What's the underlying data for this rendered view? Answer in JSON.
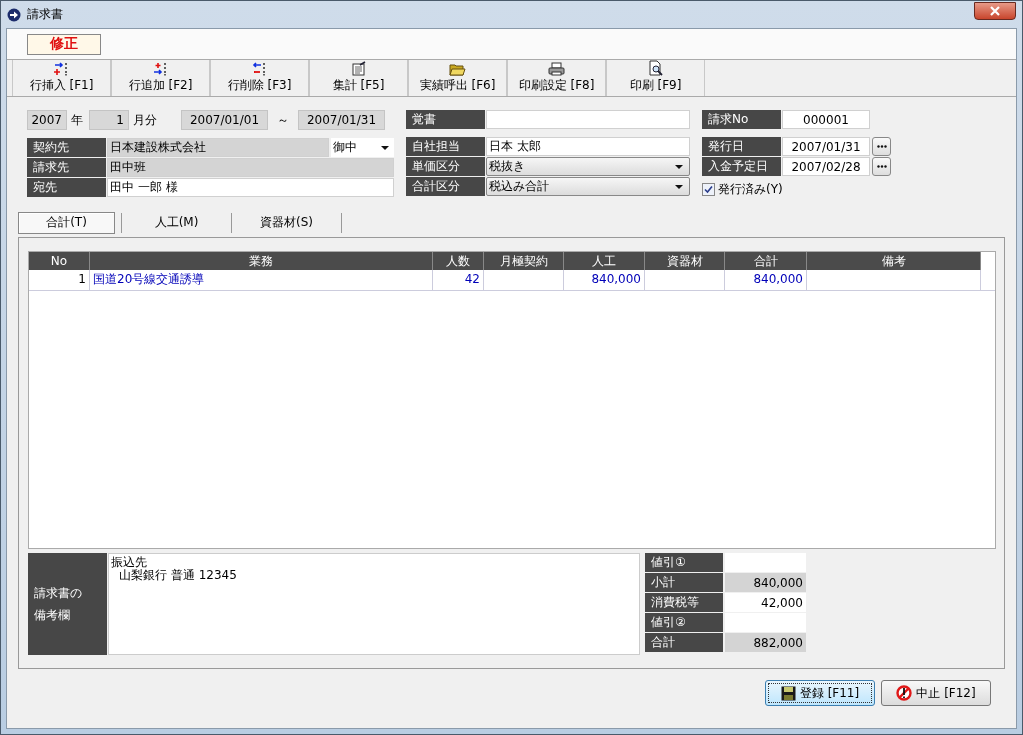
{
  "window": {
    "title": "請求書"
  },
  "mode_label": "修正",
  "toolbar": [
    {
      "label": "行挿入 [F1]",
      "kind": "insert"
    },
    {
      "label": "行追加 [F2]",
      "kind": "append"
    },
    {
      "label": "行削除 [F3]",
      "kind": "delete"
    },
    {
      "label": "集計 [F5]",
      "kind": "sum"
    },
    {
      "label": "実績呼出 [F6]",
      "kind": "load"
    },
    {
      "label": "印刷設定 [F8]",
      "kind": "printer"
    },
    {
      "label": "印刷 [F9]",
      "kind": "preview"
    }
  ],
  "period": {
    "year": "2007",
    "year_unit": "年",
    "month": "1",
    "month_unit": "月分",
    "start": "2007/01/01",
    "separator": "～",
    "end": "2007/01/31"
  },
  "client_fields": [
    {
      "label": "契約先",
      "value": "日本建設株式会社",
      "kind": "readonly",
      "honorific": "御中"
    },
    {
      "label": "請求先",
      "value": "田中班",
      "kind": "readonly"
    },
    {
      "label": "宛先",
      "value": "田中 一郎 様",
      "kind": "text"
    }
  ],
  "memo": {
    "label": "覚書"
  },
  "setting_fields": [
    {
      "label": "自社担当",
      "value": "日本 太郎",
      "kind": "text"
    },
    {
      "label": "単価区分",
      "value": "税抜き",
      "kind": "select"
    },
    {
      "label": "合計区分",
      "value": "税込み合計",
      "kind": "select"
    }
  ],
  "invoice_no": {
    "label": "請求No",
    "value": "000001"
  },
  "date_fields": [
    {
      "label": "発行日",
      "value": "2007/01/31"
    },
    {
      "label": "入金予定日",
      "value": "2007/02/28"
    }
  ],
  "issued": {
    "label": "発行済み(Y)",
    "checked": true
  },
  "tabs": [
    {
      "label": "合計(T)",
      "selected": true
    },
    {
      "label": "人工(M)",
      "selected": false
    },
    {
      "label": "資器材(S)",
      "selected": false
    }
  ],
  "table": {
    "columns": [
      "No",
      "業務",
      "人数",
      "月極契約",
      "人工",
      "資器材",
      "合計",
      "備考"
    ],
    "rows": [
      [
        "1",
        "国道20号線交通誘導",
        "42",
        null,
        "840,000",
        null,
        "840,000",
        null
      ]
    ]
  },
  "remarks": {
    "label": "請求書の備考欄",
    "lines": [
      "振込先",
      "山梨銀行 普通 12345"
    ]
  },
  "totals": [
    {
      "label": "値引①",
      "kind": "input"
    },
    {
      "label": "小計",
      "value": "840,000",
      "kind": "readonly"
    },
    {
      "label": "消費税等",
      "value": "42,000",
      "kind": "input"
    },
    {
      "label": "値引②",
      "kind": "input"
    },
    {
      "label": "合計",
      "value": "882,000",
      "kind": "readonly"
    }
  ],
  "buttons": [
    {
      "label": "登録 [F11]",
      "kind": "save",
      "focused": true
    },
    {
      "label": "中止 [F12]",
      "kind": "cancel",
      "focused": false
    }
  ]
}
